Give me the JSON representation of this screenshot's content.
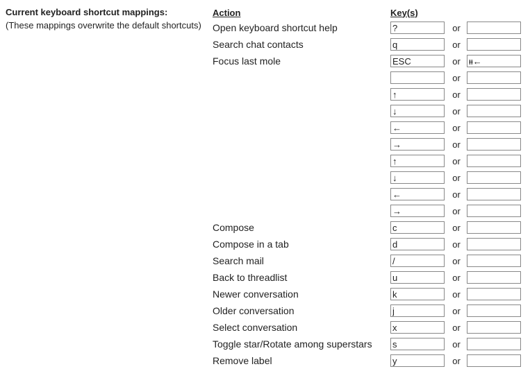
{
  "intro": {
    "heading": "Current keyboard shortcut mappings:",
    "subtext": "(These mappings overwrite the default shortcuts)"
  },
  "headers": {
    "action": "Action",
    "keys": "Key(s)"
  },
  "or_label": "or",
  "rows": [
    {
      "action": "Open keyboard shortcut help",
      "key1": "?",
      "key2": ""
    },
    {
      "action": "Search chat contacts",
      "key1": "q",
      "key2": ""
    },
    {
      "action": "Focus last mole",
      "key1": "ESC",
      "key2": "ᵼᵼ←"
    },
    {
      "action": "",
      "key1": "",
      "key2": ""
    },
    {
      "action": "",
      "key1": "↑",
      "key2": ""
    },
    {
      "action": "",
      "key1": "↓",
      "key2": ""
    },
    {
      "action": "",
      "key1": "←",
      "key2": ""
    },
    {
      "action": "",
      "key1": "→",
      "key2": ""
    },
    {
      "action": "",
      "key1": "↑",
      "key2": ""
    },
    {
      "action": "",
      "key1": "↓",
      "key2": ""
    },
    {
      "action": "",
      "key1": "←",
      "key2": ""
    },
    {
      "action": "",
      "key1": "→",
      "key2": ""
    },
    {
      "action": "Compose",
      "key1": "c",
      "key2": ""
    },
    {
      "action": "Compose in a tab",
      "key1": "d",
      "key2": ""
    },
    {
      "action": "Search mail",
      "key1": "/",
      "key2": ""
    },
    {
      "action": "Back to threadlist",
      "key1": "u",
      "key2": ""
    },
    {
      "action": "Newer conversation",
      "key1": "k",
      "key2": ""
    },
    {
      "action": "Older conversation",
      "key1": "j",
      "key2": ""
    },
    {
      "action": "Select conversation",
      "key1": "x",
      "key2": ""
    },
    {
      "action": "Toggle star/Rotate among superstars",
      "key1": "s",
      "key2": ""
    },
    {
      "action": "Remove label",
      "key1": "y",
      "key2": ""
    }
  ]
}
